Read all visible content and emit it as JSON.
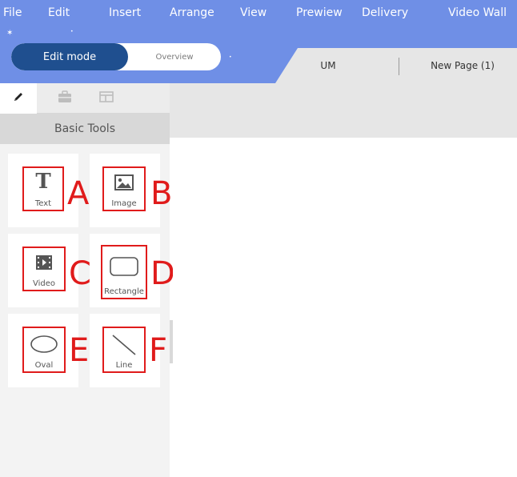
{
  "menu": {
    "items": [
      "File",
      "Edit",
      "Insert",
      "Arrange",
      "View",
      "Prewiew",
      "Delivery",
      "Video Wall"
    ]
  },
  "mode": {
    "edit_label": "Edit mode",
    "overview_label": "Overview",
    "selected": "Edit mode"
  },
  "pages": {
    "tab_um": "UM",
    "tab_new_page": "New Page (1)"
  },
  "sidebar": {
    "tabs": [
      {
        "icon": "pencil-icon",
        "active": true
      },
      {
        "icon": "briefcase-icon",
        "active": false
      },
      {
        "icon": "layout-icon",
        "active": false
      }
    ],
    "header": "Basic Tools",
    "tools": [
      {
        "label": "Text",
        "icon": "text-icon",
        "callout": "A"
      },
      {
        "label": "Image",
        "icon": "image-icon",
        "callout": "B"
      },
      {
        "label": "Video",
        "icon": "video-icon",
        "callout": "C"
      },
      {
        "label": "Rectangle",
        "icon": "rectangle-icon",
        "callout": "D"
      },
      {
        "label": "Oval",
        "icon": "oval-icon",
        "callout": "E"
      },
      {
        "label": "Line",
        "icon": "line-icon",
        "callout": "F"
      }
    ]
  },
  "colors": {
    "topbar": "#6f8fe6",
    "edit_mode_active": "#1f4f8f",
    "annotation_red": "#e01b1b"
  }
}
